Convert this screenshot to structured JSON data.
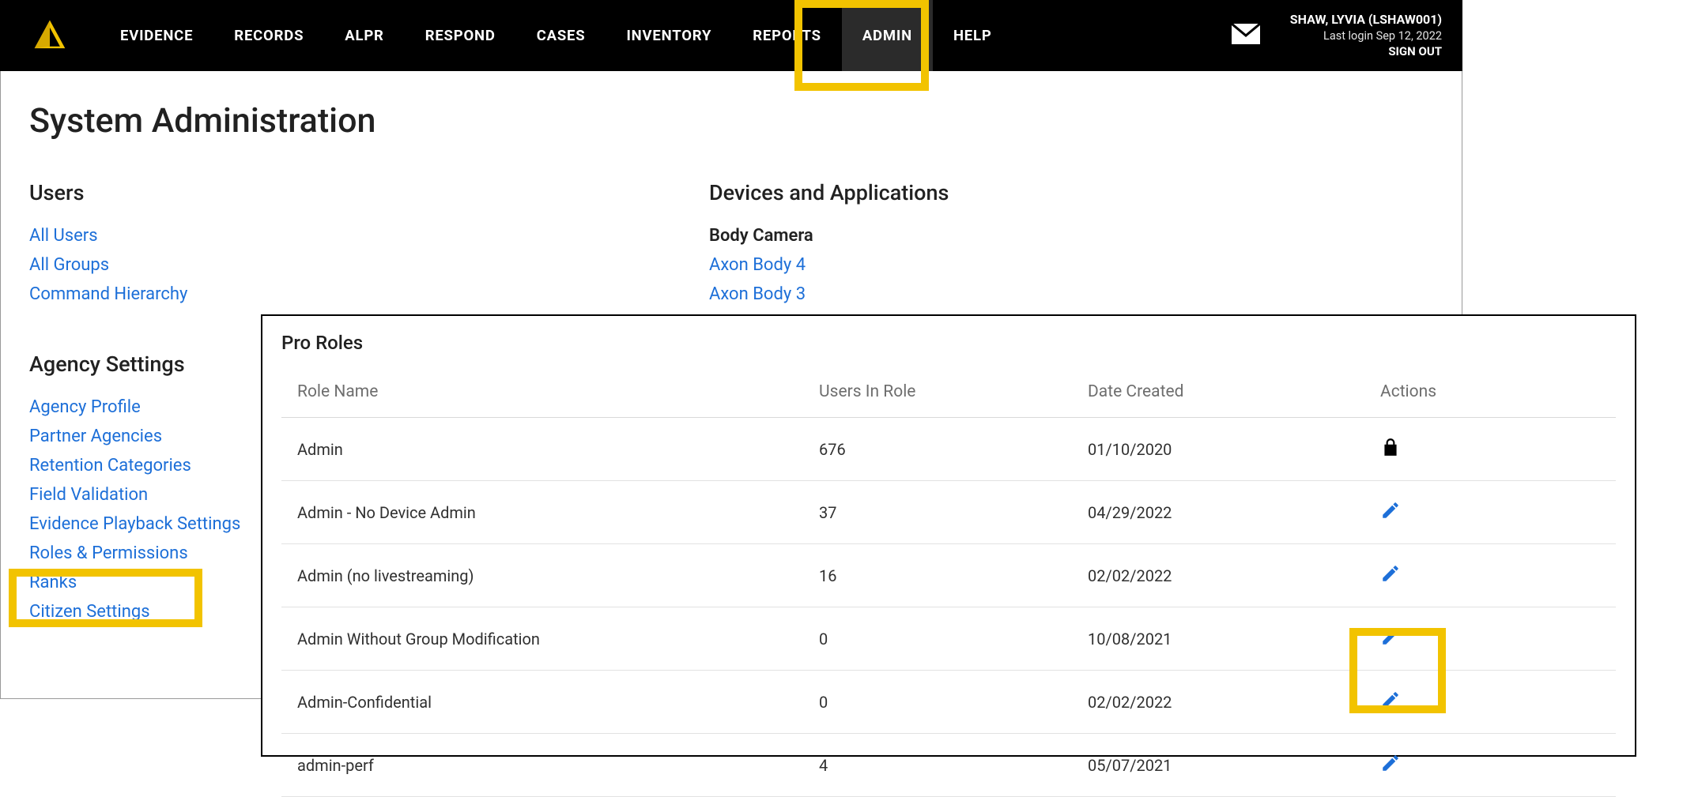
{
  "nav": {
    "items": [
      "EVIDENCE",
      "RECORDS",
      "ALPR",
      "RESPOND",
      "CASES",
      "INVENTORY",
      "REPORTS",
      "ADMIN",
      "HELP"
    ],
    "active_index": 7
  },
  "user": {
    "name": "SHAW, LYVIA (LSHAW001)",
    "last_login": "Last login Sep 12, 2022",
    "sign_out": "SIGN OUT"
  },
  "page_title": "System Administration",
  "sections": {
    "users": {
      "title": "Users",
      "links": [
        "All Users",
        "All Groups",
        "Command Hierarchy"
      ]
    },
    "devices": {
      "title": "Devices and Applications",
      "sub_title": "Body Camera",
      "links": [
        "Axon Body 4",
        "Axon Body 3"
      ]
    },
    "agency": {
      "title": "Agency Settings",
      "links": [
        "Agency Profile",
        "Partner Agencies",
        "Retention Categories",
        "Field Validation",
        "Evidence Playback Settings",
        "Roles & Permissions",
        "Ranks",
        "Citizen Settings"
      ]
    }
  },
  "overlay": {
    "title": "Pro Roles",
    "columns": [
      "Role Name",
      "Users In Role",
      "Date Created",
      "Actions"
    ],
    "rows": [
      {
        "name": "Admin",
        "users": "676",
        "date": "01/10/2020",
        "action": "lock"
      },
      {
        "name": "Admin - No Device Admin",
        "users": "37",
        "date": "04/29/2022",
        "action": "edit"
      },
      {
        "name": "Admin (no livestreaming)",
        "users": "16",
        "date": "02/02/2022",
        "action": "edit"
      },
      {
        "name": "Admin Without Group Modification",
        "users": "0",
        "date": "10/08/2021",
        "action": "edit"
      },
      {
        "name": "Admin-Confidential",
        "users": "0",
        "date": "02/02/2022",
        "action": "edit"
      },
      {
        "name": "admin-perf",
        "users": "4",
        "date": "05/07/2021",
        "action": "edit"
      }
    ]
  },
  "colors": {
    "accent": "#f2c300",
    "link": "#1d6fd8"
  }
}
